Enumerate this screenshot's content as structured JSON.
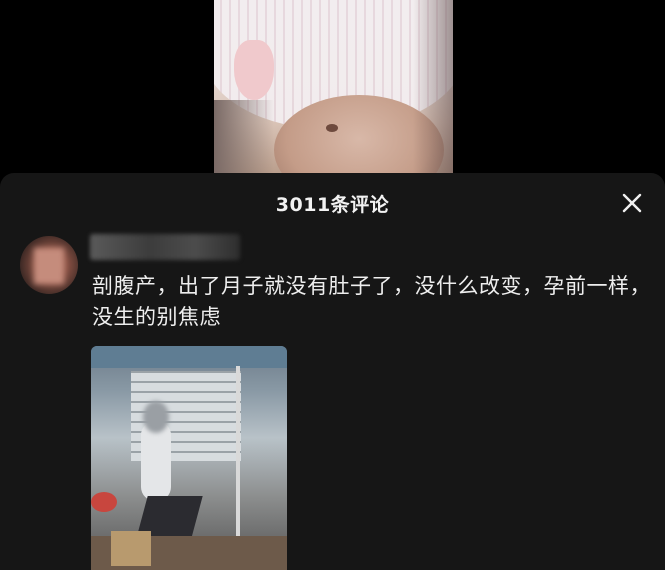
{
  "comments_panel": {
    "title": "3011条评论"
  },
  "comment": {
    "username": "",
    "text": "剖腹产，出了月子就没有肚子了，没什么改变，孕前一样，没生的别焦虑"
  }
}
